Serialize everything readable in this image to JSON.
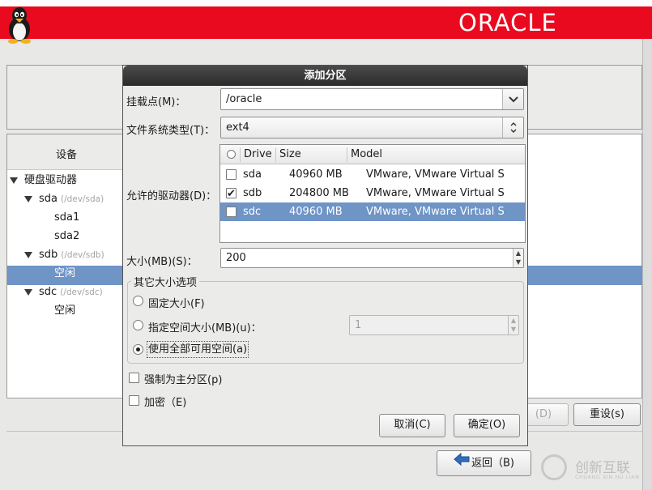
{
  "brand": {
    "logo_text": "ORACLE"
  },
  "tree": {
    "header": "设备",
    "items": [
      {
        "label": "硬盘驱动器",
        "sub": ""
      },
      {
        "label": "sda",
        "sub": "(/dev/sda)"
      },
      {
        "label": "sda1",
        "sub": ""
      },
      {
        "label": "sda2",
        "sub": ""
      },
      {
        "label": "sdb",
        "sub": "(/dev/sdb)"
      },
      {
        "label": "空闲",
        "sub": ""
      },
      {
        "label": "sdc",
        "sub": "(/dev/sdc)"
      },
      {
        "label": "空闲",
        "sub": ""
      }
    ]
  },
  "page_buttons": {
    "delete": "(D)",
    "reset": "重设(s)",
    "back": "返回（B)"
  },
  "dialog": {
    "title": "添加分区",
    "mount_label": "挂载点(M)：",
    "mount_value": "/oracle",
    "fstype_label": "文件系统类型(T)：",
    "fstype_value": "ext4",
    "drives_label": "允许的驱动器(D)：",
    "drive_columns": [
      "Drive",
      "Size",
      "Model"
    ],
    "drives": [
      {
        "drive": "sda",
        "size": "40960 MB",
        "model": "VMware, VMware Virtual S",
        "checked": false,
        "selected": false
      },
      {
        "drive": "sdb",
        "size": "204800 MB",
        "model": "VMware, VMware Virtual S",
        "checked": true,
        "selected": false
      },
      {
        "drive": "sdc",
        "size": "40960 MB",
        "model": "VMware, VMware Virtual S",
        "checked": false,
        "selected": true
      }
    ],
    "size_label": "大小(MB)(S)：",
    "size_value": "200",
    "other_size_title": "其它大小选项",
    "opt_fixed": "固定大小(F)",
    "opt_upto": "指定空间大小(MB)(u)：",
    "opt_upto_value": "1",
    "opt_fill": "使用全部可用空间(a)",
    "selected_option": "fill",
    "force_primary": "强制为主分区(p)",
    "encrypt": "加密（E)",
    "cancel": "取消(C)",
    "ok": "确定(O)"
  },
  "watermark": {
    "text": "创新互联",
    "sub": "CHUANG XIN HU LIAN"
  }
}
